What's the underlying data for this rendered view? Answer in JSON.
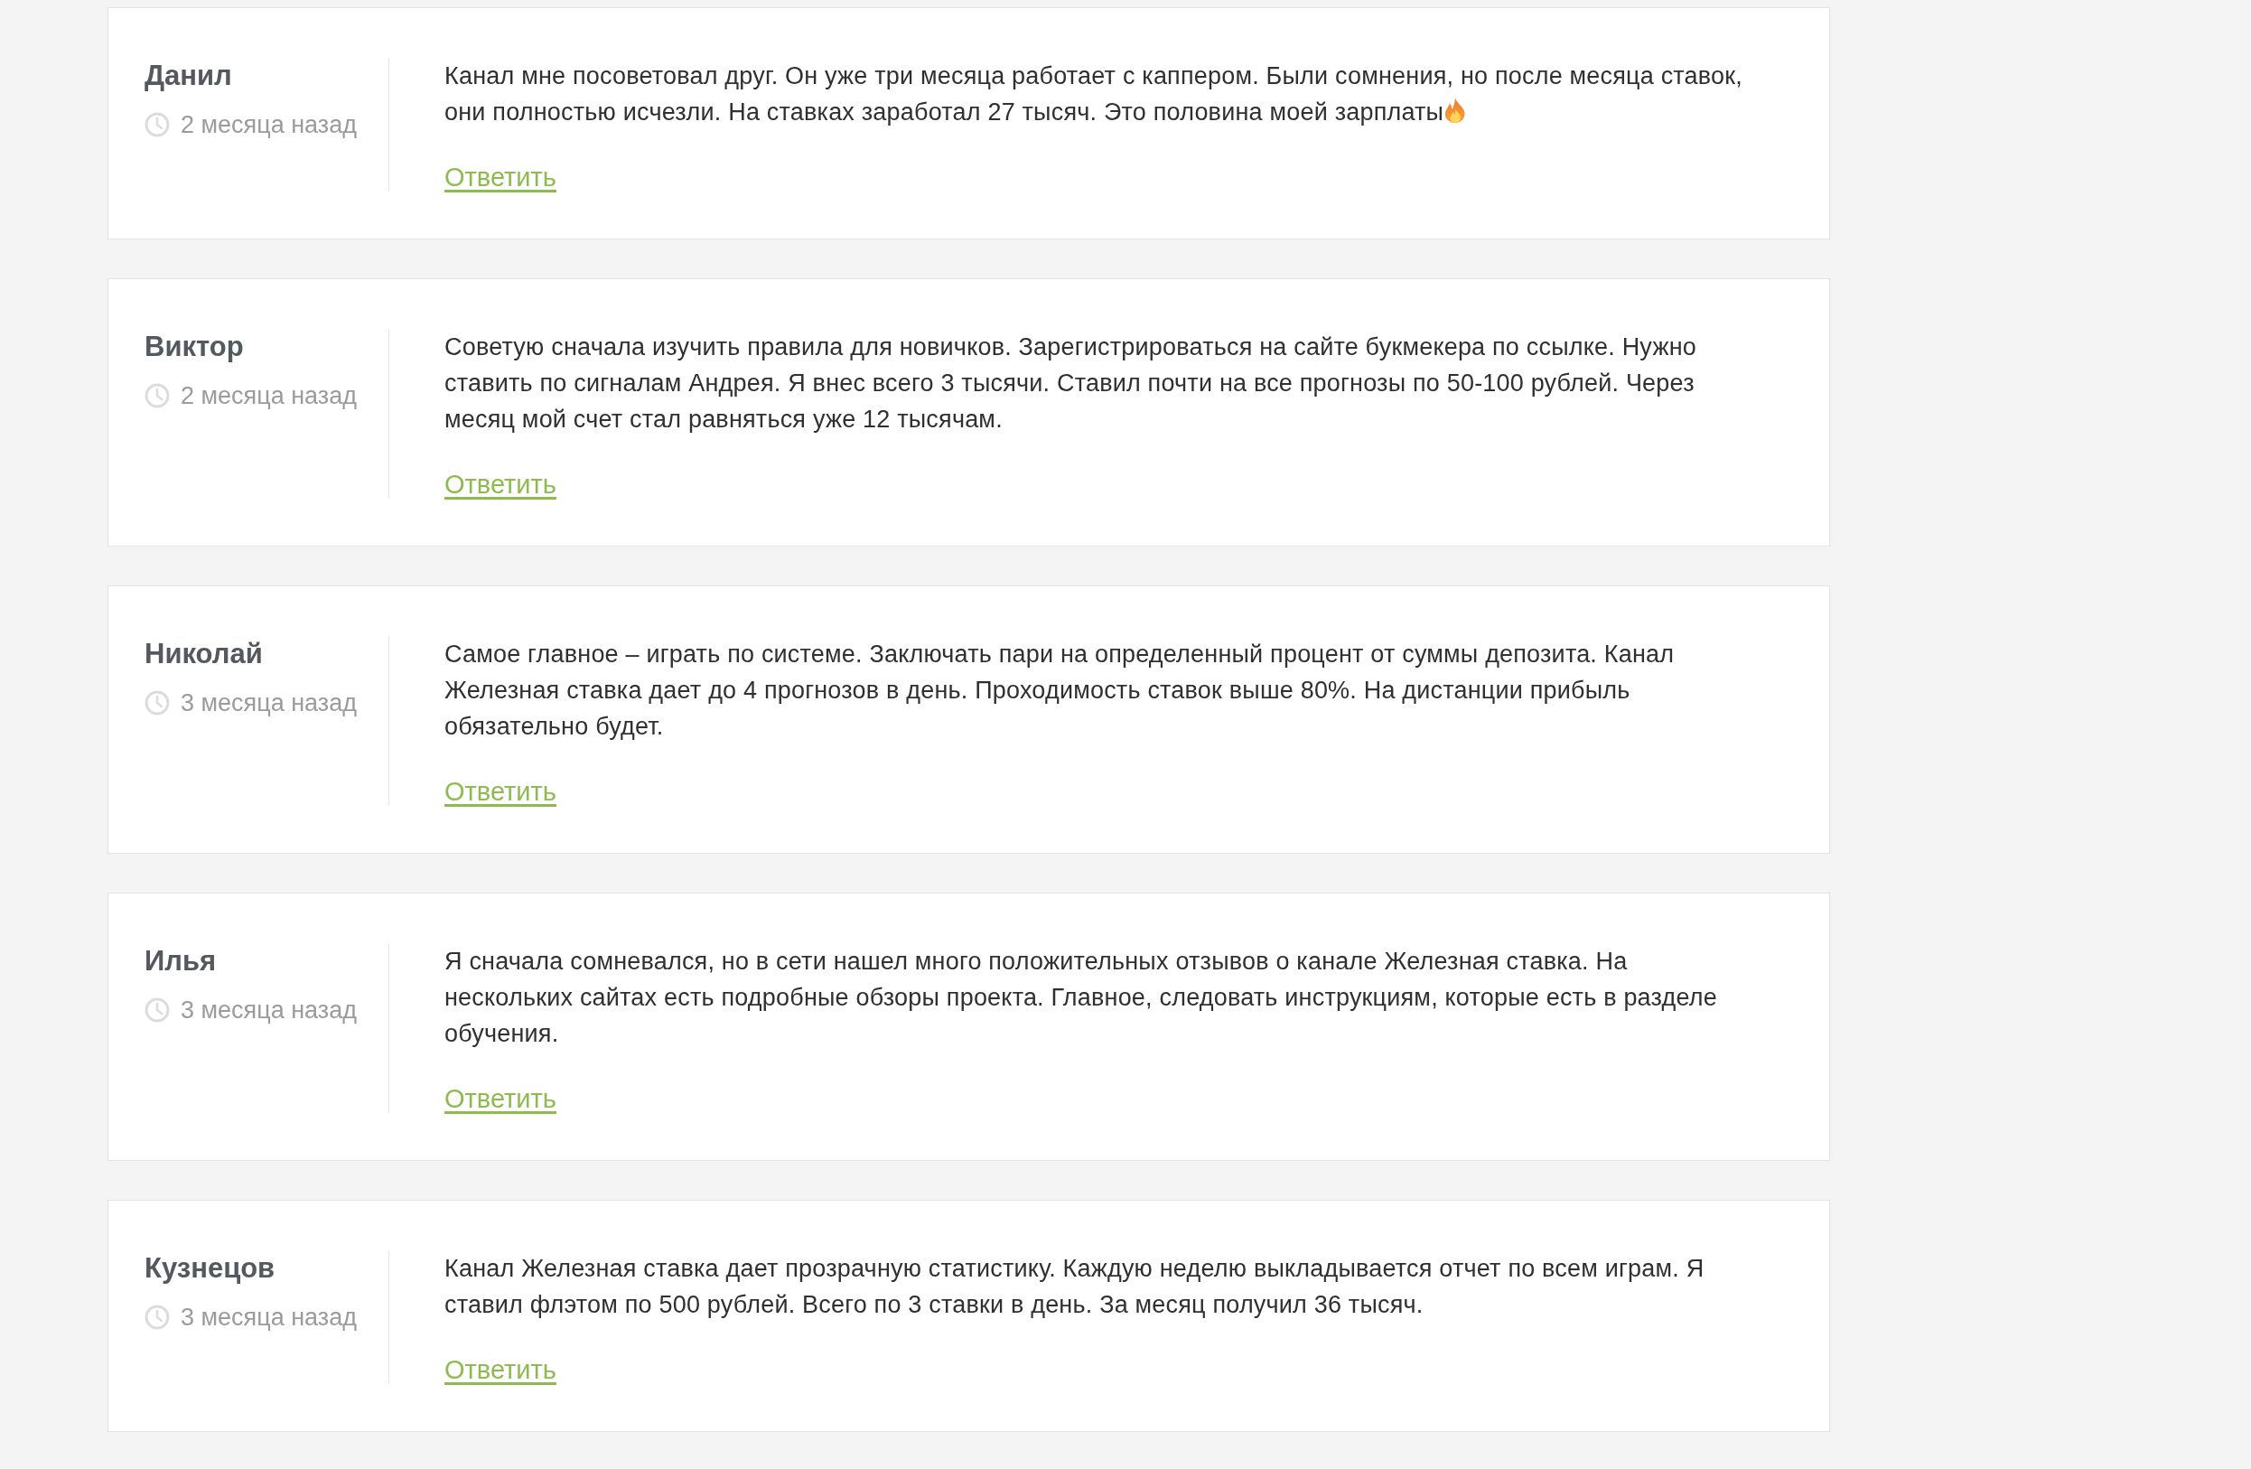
{
  "comments": [
    {
      "author": "Данил",
      "time": "2 месяца назад",
      "text": "Канал мне посоветовал друг. Он уже три месяца работает с каппером. Были сомнения, но после месяца ставок, они полностью исчезли. На ставках заработал 27 тысяч. Это половина моей зарплаты",
      "emoji": true,
      "reply": "Ответить"
    },
    {
      "author": "Виктор",
      "time": "2 месяца назад",
      "text": "Советую сначала изучить правила для новичков. Зарегистрироваться на сайте букмекера по ссылке. Нужно ставить по сигналам Андрея. Я внес всего 3 тысячи. Ставил почти на все прогнозы по 50-100 рублей. Через месяц мой счет стал равняться уже 12 тысячам.",
      "emoji": false,
      "reply": "Ответить"
    },
    {
      "author": "Николай",
      "time": "3 месяца назад",
      "text": "Самое главное – играть по системе. Заключать пари на определенный процент от суммы депозита. Канал Железная ставка дает до 4 прогнозов в день. Проходимость ставок выше 80%. На дистанции прибыль обязательно будет.",
      "emoji": false,
      "reply": "Ответить"
    },
    {
      "author": "Илья",
      "time": "3 месяца назад",
      "text": "Я сначала сомневался, но в сети нашел много положительных отзывов о канале Железная ставка. На нескольких сайтах есть подробные обзоры проекта. Главное, следовать инструкциям, которые есть в разделе обучения.",
      "emoji": false,
      "reply": "Ответить"
    },
    {
      "author": "Кузнецов",
      "time": "3 месяца назад",
      "text": "Канал Железная ставка дает прозрачную статистику. Каждую неделю выкладывается отчет по всем играм. Я ставил флэтом по 500 рублей. Всего по 3 ставки в день. За месяц получил 36 тысяч.",
      "emoji": false,
      "reply": "Ответить"
    }
  ]
}
